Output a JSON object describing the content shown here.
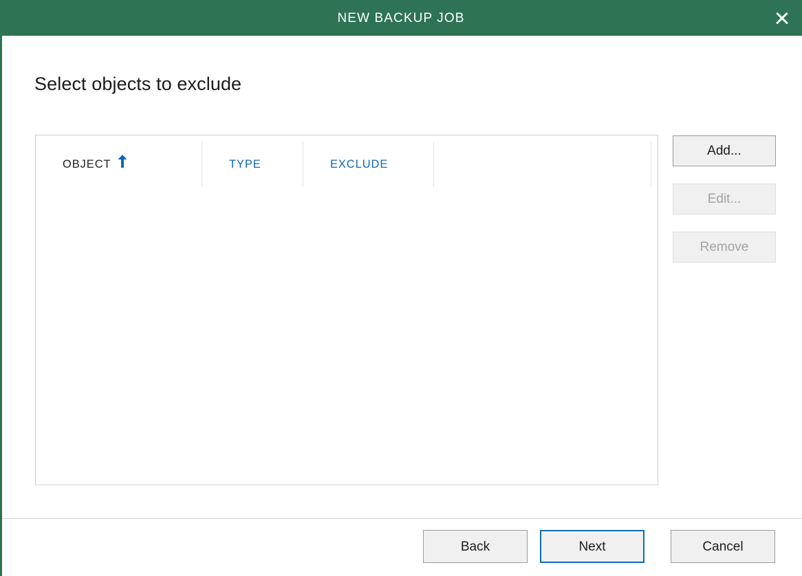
{
  "window": {
    "title": "NEW BACKUP JOB",
    "close_icon": "close-icon",
    "accent_color": "#2d7354",
    "link_color": "#1266b0",
    "focus_color": "#0d6ab5"
  },
  "page": {
    "heading": "Select objects to exclude"
  },
  "table": {
    "columns": [
      {
        "label": "OBJECT",
        "sorted": true,
        "sort_direction": "ascending",
        "sort_icon": "sort-arrow-up-icon"
      },
      {
        "label": "TYPE",
        "sorted": false
      },
      {
        "label": "EXCLUDE",
        "sorted": false
      },
      {
        "label": "",
        "sorted": false
      }
    ],
    "rows": []
  },
  "side_buttons": [
    {
      "label": "Add...",
      "enabled": true
    },
    {
      "label": "Edit...",
      "enabled": false
    },
    {
      "label": "Remove",
      "enabled": false
    }
  ],
  "footer_buttons": [
    {
      "label": "Back",
      "enabled": true,
      "focused": false
    },
    {
      "label": "Next",
      "enabled": true,
      "focused": true
    },
    {
      "label": "Cancel",
      "enabled": true,
      "focused": false
    }
  ]
}
